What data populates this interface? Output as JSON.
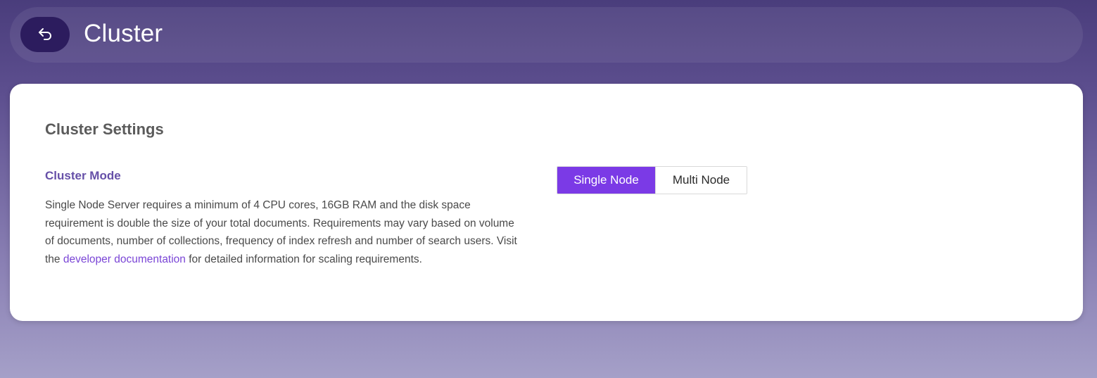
{
  "header": {
    "title": "Cluster",
    "back_icon": "undo-arrow-icon"
  },
  "settings": {
    "section_title": "Cluster Settings",
    "cluster_mode": {
      "title": "Cluster Mode",
      "description_before": "Single Node Server requires a minimum of 4 CPU cores, 16GB RAM and the disk space requirement is double the size of your total documents. Requirements may vary based on volume of documents, number of collections, frequency of index refresh and number of search users. Visit the ",
      "link_text": "developer documentation",
      "description_after": " for detailed information for scaling requirements.",
      "options": [
        "Single Node",
        "Multi Node"
      ],
      "selected": "Single Node"
    }
  },
  "colors": {
    "accent": "#7b3ae6",
    "link": "#7a45d6",
    "mode_title": "#6650a8",
    "back_button": "#2c1c5e"
  }
}
